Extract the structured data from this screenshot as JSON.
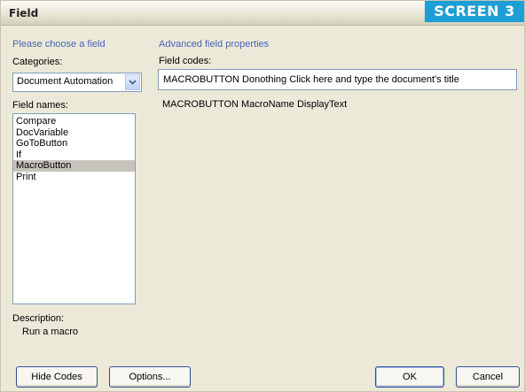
{
  "window": {
    "title": "Field",
    "badge": "SCREEN 3"
  },
  "left": {
    "group_header": "Please choose a field",
    "categories_label": "Categories:",
    "categories_value": "Document Automation",
    "field_names_label": "Field names:",
    "field_names": [
      "Compare",
      "DocVariable",
      "GoToButton",
      "If",
      "MacroButton",
      "Print"
    ],
    "selected_field": "MacroButton",
    "description_label": "Description:",
    "description_value": "Run a macro"
  },
  "right": {
    "group_header": "Advanced field properties",
    "field_codes_label": "Field codes:",
    "field_codes_value": "MACROBUTTON  Donothing Click here and type the document's title",
    "syntax": "MACROBUTTON MacroName DisplayText"
  },
  "buttons": {
    "hide_codes": "Hide Codes",
    "options": "Options...",
    "ok": "OK",
    "cancel": "Cancel"
  },
  "icons": {
    "dropdown": "chevron-down-icon"
  }
}
